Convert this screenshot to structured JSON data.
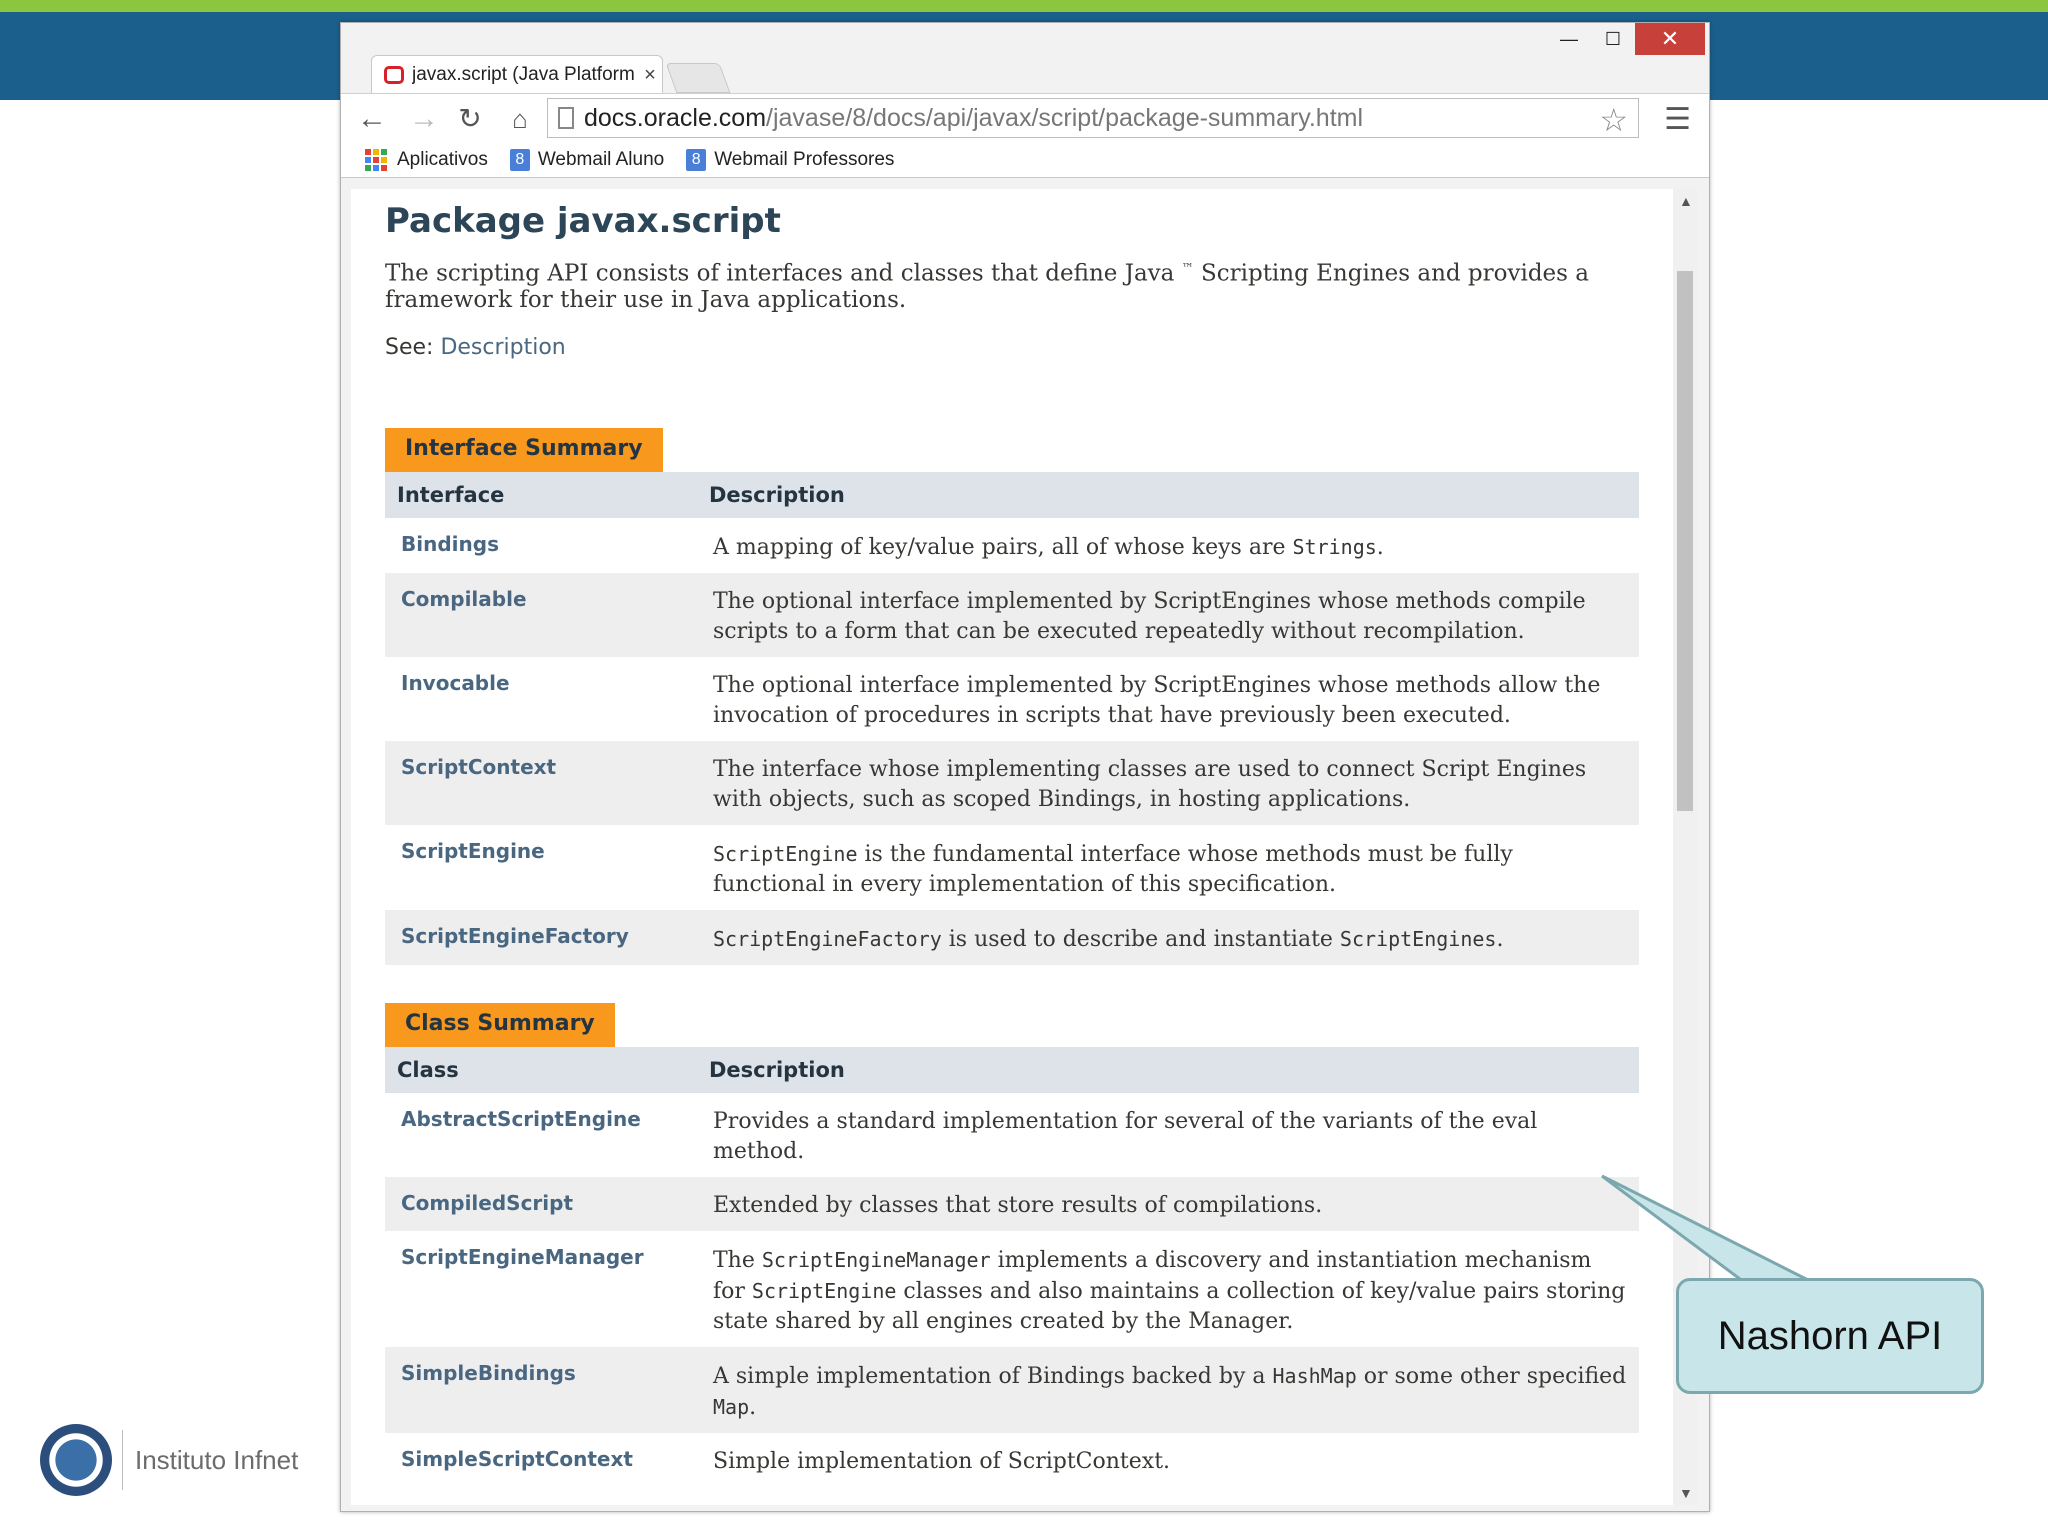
{
  "browser": {
    "tab_title": "javax.script (Java Platform",
    "tab_close": "×",
    "url_host": "docs.oracle.com",
    "url_path": "/javase/8/docs/api/javax/script/package-summary.html",
    "bookmarks": [
      "Aplicativos",
      "Webmail Aluno",
      "Webmail Professores"
    ],
    "window_controls": {
      "minimize": "—",
      "maximize": "☐",
      "close": "✕"
    }
  },
  "page": {
    "title": "Package javax.script",
    "intro_1": "The scripting API consists of interfaces and classes that define Java ",
    "tm": "™",
    "intro_2": " Scripting Engines and provides a framework for their use in Java applications.",
    "see_label": "See: ",
    "see_link": "Description"
  },
  "interface_summary": {
    "caption": "Interface Summary",
    "col1": "Interface",
    "col2": "Description",
    "rows": [
      {
        "name": "Bindings",
        "desc_a": "A mapping of key/value pairs, all of whose keys are ",
        "code_a": "Strings",
        "desc_b": "."
      },
      {
        "name": "Compilable",
        "desc_a": "The optional interface implemented by ScriptEngines whose methods compile scripts to a form that can be executed repeatedly without recompilation."
      },
      {
        "name": "Invocable",
        "desc_a": "The optional interface implemented by ScriptEngines whose methods allow the invocation of procedures in scripts that have previously been executed."
      },
      {
        "name": "ScriptContext",
        "desc_a": "The interface whose implementing classes are used to connect Script Engines with objects, such as scoped Bindings, in hosting applications."
      },
      {
        "name": "ScriptEngine",
        "code_a": "ScriptEngine",
        "desc_a": " is the fundamental interface whose methods must be fully functional in every implementation of this specification."
      },
      {
        "name": "ScriptEngineFactory",
        "code_a": "ScriptEngineFactory",
        "desc_a": " is used to describe and instantiate ",
        "code_b": "ScriptEngines",
        "desc_b": "."
      }
    ]
  },
  "class_summary": {
    "caption": "Class Summary",
    "col1": "Class",
    "col2": "Description",
    "rows": [
      {
        "name": "AbstractScriptEngine",
        "desc_a": "Provides a standard implementation for several of the variants of the eval method."
      },
      {
        "name": "CompiledScript",
        "desc_a": "Extended by classes that store results of compilations."
      },
      {
        "name": "ScriptEngineManager",
        "desc_a": "The ",
        "code_a": "ScriptEngineManager",
        "desc_b": " implements a discovery and instantiation mechanism for ",
        "code_b": "ScriptEngine",
        "desc_c": " classes and also maintains a collection of key/value pairs storing state shared by all engines created by the Manager."
      },
      {
        "name": "SimpleBindings",
        "desc_a": "A simple implementation of Bindings backed by a ",
        "code_a": "HashMap",
        "desc_b": " or some other specified ",
        "code_b": "Map",
        "desc_c": "."
      },
      {
        "name": "SimpleScriptContext",
        "desc_a": "Simple implementation of ScriptContext."
      }
    ]
  },
  "callout": {
    "text": "Nashorn API"
  },
  "logo": {
    "text": "Instituto Infnet"
  },
  "colors": {
    "accent": "#f8981d",
    "header_row": "#dee3e9",
    "link": "#4a6782",
    "slide_band": "#1b5f8c",
    "callout_fill": "#c8e6ea"
  }
}
